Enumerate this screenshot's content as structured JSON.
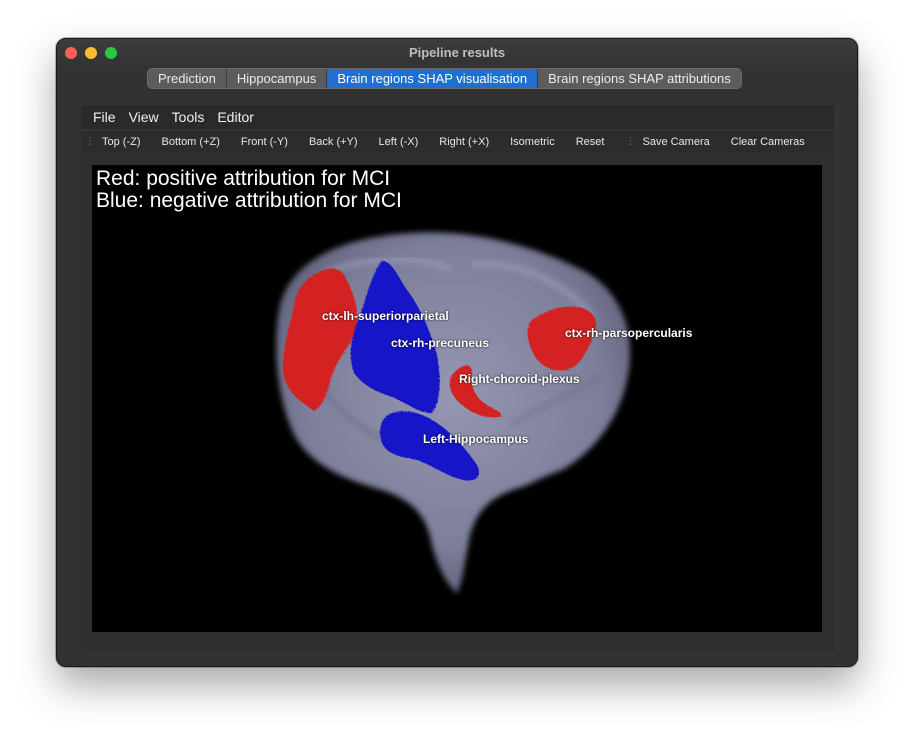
{
  "window": {
    "title": "Pipeline results",
    "tabs": [
      {
        "label": "Prediction"
      },
      {
        "label": "Hippocampus"
      },
      {
        "label": "Brain regions SHAP visualisation",
        "active": true
      },
      {
        "label": "Brain regions SHAP attributions"
      }
    ]
  },
  "menubar": [
    "File",
    "View",
    "Tools",
    "Editor"
  ],
  "toolbar": {
    "camera_buttons": [
      "Top (-Z)",
      "Bottom (+Z)",
      "Front (-Y)",
      "Back (+Y)",
      "Left (-X)",
      "Right (+X)",
      "Isometric",
      "Reset"
    ],
    "save_camera": "Save Camera",
    "clear_cameras": "Clear Cameras"
  },
  "viewport": {
    "legend": {
      "line1": "Red: positive attribution for MCI",
      "line2": "Blue: negative attribution for MCI"
    },
    "regions": [
      {
        "label": "ctx-lh-superiorparietal",
        "attribution": "positive",
        "color": "#d42020"
      },
      {
        "label": "ctx-rh-precuneus",
        "attribution": "negative",
        "color": "#1818c8"
      },
      {
        "label": "ctx-rh-parsopercularis",
        "attribution": "positive",
        "color": "#d42020"
      },
      {
        "label": "Right-choroid-plexus",
        "attribution": "positive",
        "color": "#d42020"
      },
      {
        "label": "Left-Hippocampus",
        "attribution": "negative",
        "color": "#1818c8"
      }
    ]
  },
  "colors": {
    "positive": "#d42020",
    "negative": "#1818c8",
    "brain": "#8a8ca8",
    "active_tab": "#1f6fd0"
  }
}
